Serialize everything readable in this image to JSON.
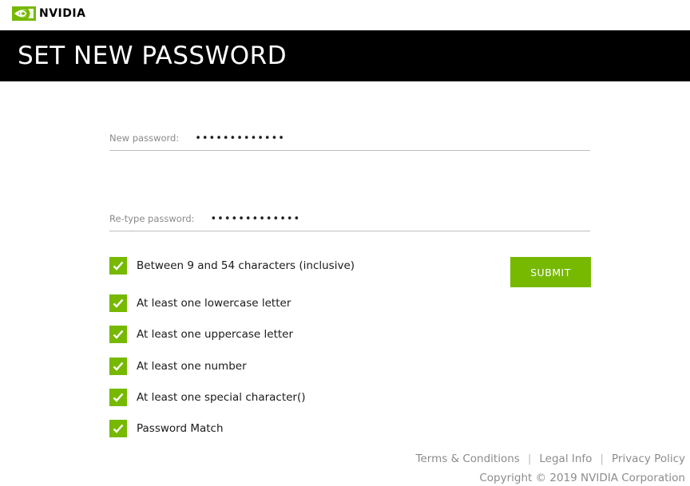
{
  "brand": {
    "logo_text": "NVIDIA",
    "accent_color": "#76b900",
    "logo_icon": "nvidia-eye-icon"
  },
  "header": {
    "title": "SET NEW PASSWORD",
    "background_color": "#000000"
  },
  "form": {
    "new_password": {
      "label": "New password:",
      "value": "•••••••••••••"
    },
    "retype_password": {
      "label": "Re-type password:",
      "value": "•••••••••••••"
    },
    "submit_label": "SUBMIT"
  },
  "requirements": [
    {
      "label": "Between 9 and 54 characters (inclusive)",
      "checked": true
    },
    {
      "label": "At least one lowercase letter",
      "checked": true
    },
    {
      "label": "At least one uppercase letter",
      "checked": true
    },
    {
      "label": "At least one number",
      "checked": true
    },
    {
      "label": "At least one special character()",
      "checked": true
    },
    {
      "label": "Password Match",
      "checked": true
    }
  ],
  "footer": {
    "links": [
      {
        "label": "Terms & Conditions"
      },
      {
        "label": "Legal Info"
      },
      {
        "label": "Privacy Policy"
      }
    ],
    "separator": "|",
    "copyright": "Copyright © 2019 NVIDIA Corporation"
  }
}
